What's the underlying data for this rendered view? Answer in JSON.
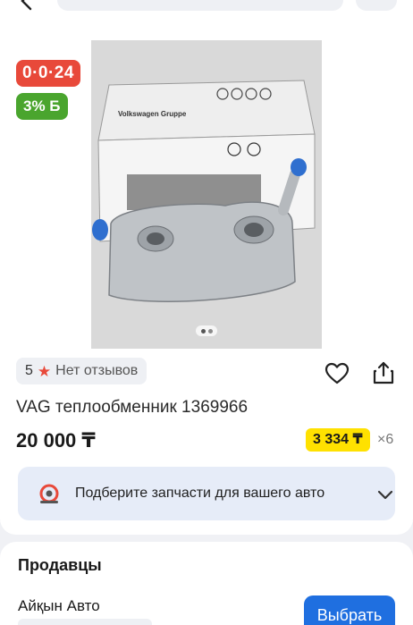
{
  "header": {
    "back_icon": "arrow-left-icon",
    "search_placeholder": "",
    "right_icon": "menu-icon"
  },
  "badges": {
    "timer": "0·0·24",
    "bonus": "3% Б"
  },
  "gallery": {
    "image_alt": "Product photo: Volkswagen Gruppe box and oil cooler heat exchanger",
    "box_label": "Volkswagen Gruppe",
    "pages": 2,
    "current_page": 1
  },
  "rating": {
    "score": "5",
    "reviews_text": "Нет отзывов"
  },
  "product": {
    "title": "VAG теплообменник 1369966",
    "price": "20 000 ₸",
    "installment_amount": "3 334 ₸",
    "installment_multiplier": "×6"
  },
  "parts_banner": {
    "text": "Подберите запчасти для вашего авто"
  },
  "sellers": {
    "title": "Продавцы",
    "items": [
      {
        "name": "Айқын Авто",
        "button_label": "Выбрать"
      }
    ]
  },
  "colors": {
    "timer_badge": "#e8493a",
    "bonus_badge": "#4aa52e",
    "installment": "#ffe100",
    "primary_button": "#1f6fe0",
    "banner_bg": "#e6ecf8"
  }
}
